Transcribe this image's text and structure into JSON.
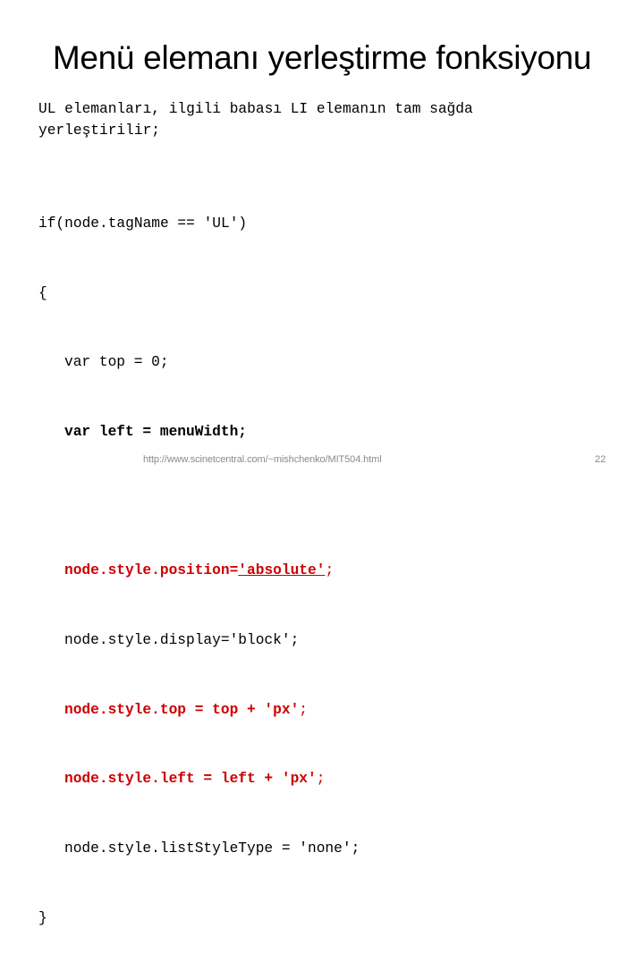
{
  "slide": {
    "title": "Menü elemanı yerleştirme fonksiyonu",
    "description_lines": [
      "UL elemanları, ilgili babası LI elemanın tam sağda",
      "yerleştirilir;"
    ],
    "code": {
      "line_if": "if(node.tagName == 'UL')",
      "line_open": "{",
      "line_var_top": "var top = 0;",
      "line_var_left": "var left = menuWidth;",
      "line_position_prefix": "node.style.position=",
      "line_position_value": "'absolute'",
      "line_position_suffix": ";",
      "line_display": "node.style.display='block';",
      "line_top_main": "node.style.top = top + 'px'",
      "line_top_suffix": ";",
      "line_left_main": "node.style.left = left + 'px'",
      "line_left_suffix": ";",
      "line_list_style": "node.style.listStyleType = 'none';",
      "line_close": "}"
    },
    "colors": {
      "highlight": "#cc0000",
      "footer_text": "#8a8a8a"
    },
    "footer": {
      "url": "http://www.scinetcentral.com/~mishchenko/MIT504.html",
      "page_number": "22"
    }
  }
}
